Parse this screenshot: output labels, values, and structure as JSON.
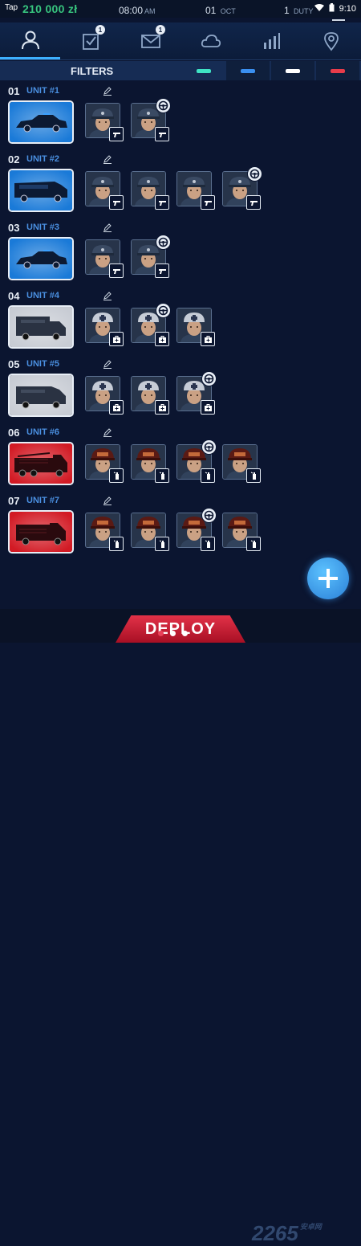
{
  "status": {
    "carrier": "Tap",
    "money": "210 000 zł",
    "time": "08:00",
    "time_suffix": "AM",
    "date_day": "01",
    "date_month": "OCT",
    "duty_num": "1",
    "duty_label": "DUTY",
    "clock": "9:10"
  },
  "nav": {
    "tabs": [
      {
        "name": "profile",
        "icon": "person-icon"
      },
      {
        "name": "tasks",
        "icon": "checklist-icon",
        "badge": "1"
      },
      {
        "name": "messages",
        "icon": "envelope-icon",
        "badge": "1"
      },
      {
        "name": "cloud",
        "icon": "cloud-icon"
      },
      {
        "name": "stats",
        "icon": "bar-chart-icon"
      },
      {
        "name": "map",
        "icon": "map-pin-icon"
      }
    ]
  },
  "filters": {
    "label": "FILTERS",
    "chips": [
      {
        "color": "#3fe3c4"
      },
      {
        "color": "#3a8ff0"
      },
      {
        "color": "#ffffff"
      },
      {
        "color": "#e83c4a"
      }
    ]
  },
  "units": [
    {
      "num": "01",
      "name": "UNIT #1",
      "vehicle": "police-car",
      "color": "#1a7ad8",
      "crew": [
        {
          "type": "police",
          "role": "gun",
          "driver": false
        },
        {
          "type": "police",
          "role": "gun",
          "driver": true
        }
      ]
    },
    {
      "num": "02",
      "name": "UNIT #2",
      "vehicle": "police-van",
      "color": "#1a7ad8",
      "crew": [
        {
          "type": "police",
          "role": "gun",
          "driver": false
        },
        {
          "type": "police",
          "role": "gun",
          "driver": false
        },
        {
          "type": "police",
          "role": "gun",
          "driver": false
        },
        {
          "type": "police",
          "role": "gun",
          "driver": true
        }
      ]
    },
    {
      "num": "03",
      "name": "UNIT #3",
      "vehicle": "police-car",
      "color": "#1a7ad8",
      "crew": [
        {
          "type": "police",
          "role": "gun",
          "driver": false
        },
        {
          "type": "police",
          "role": "gun",
          "driver": true
        }
      ]
    },
    {
      "num": "04",
      "name": "UNIT #4",
      "vehicle": "ambulance",
      "color": "#c8ccd4",
      "crew": [
        {
          "type": "medic",
          "role": "medkit",
          "driver": false
        },
        {
          "type": "medic",
          "role": "medkit",
          "driver": true
        },
        {
          "type": "medic",
          "role": "medkit",
          "driver": false
        }
      ]
    },
    {
      "num": "05",
      "name": "UNIT #5",
      "vehicle": "ambulance-van",
      "color": "#c8ccd4",
      "crew": [
        {
          "type": "medic",
          "role": "medkit",
          "driver": false
        },
        {
          "type": "medic",
          "role": "medkit",
          "driver": false
        },
        {
          "type": "medic",
          "role": "medkit",
          "driver": true
        }
      ]
    },
    {
      "num": "06",
      "name": "UNIT #6",
      "vehicle": "fire-truck",
      "color": "#d21a24",
      "crew": [
        {
          "type": "fire",
          "role": "extinguisher",
          "driver": false
        },
        {
          "type": "fire",
          "role": "extinguisher",
          "driver": false
        },
        {
          "type": "fire",
          "role": "extinguisher",
          "driver": true
        },
        {
          "type": "fire",
          "role": "extinguisher",
          "driver": false
        }
      ]
    },
    {
      "num": "07",
      "name": "UNIT #7",
      "vehicle": "fire-truck-small",
      "color": "#d21a24",
      "crew": [
        {
          "type": "fire",
          "role": "extinguisher",
          "driver": false
        },
        {
          "type": "fire",
          "role": "extinguisher",
          "driver": false
        },
        {
          "type": "fire",
          "role": "extinguisher",
          "driver": true
        },
        {
          "type": "fire",
          "role": "extinguisher",
          "driver": false
        }
      ]
    }
  ],
  "deploy_label": "DEPLOY",
  "watermark": "2265",
  "watermark_small": "安卓网",
  "page_dots": [
    {
      "active": true
    },
    {
      "active": false
    },
    {
      "active": false
    }
  ]
}
